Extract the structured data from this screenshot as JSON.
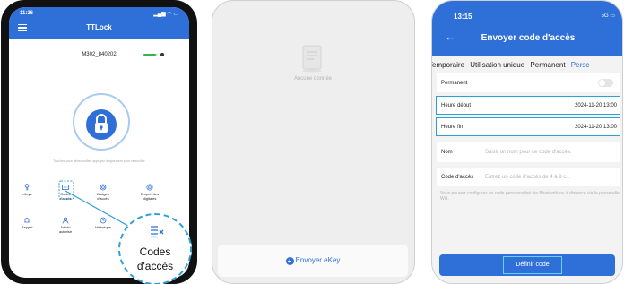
{
  "phone1": {
    "time": "11:36",
    "status_icons": "signal-wifi-battery",
    "title": "TTLock",
    "lock_name": "M302_840202",
    "battery_level": 0.85,
    "hint": "Touchez pour déverrouiller, appuyez longuement pour verrouiller",
    "menu": [
      {
        "label": "eKeys",
        "icon": "key-icon"
      },
      {
        "label": "Codes d'accès",
        "icon": "passcode-icon"
      },
      {
        "label": "Badges d'accès",
        "icon": "card-icon"
      },
      {
        "label": "Empreintes digitales",
        "icon": "fingerprint-icon"
      },
      {
        "label": "Rappel",
        "icon": "bell-icon"
      },
      {
        "label": "Admin autorisé",
        "icon": "admin-icon"
      },
      {
        "label": "Historique",
        "icon": "history-icon"
      },
      {
        "label": "Paramètres",
        "icon": "gear-icon"
      }
    ],
    "zoom_label": "Codes d'accès"
  },
  "phone2": {
    "empty_text": "Aucune donnée",
    "send_button": "Envoyer eKey"
  },
  "phone3": {
    "time": "13:15",
    "status_text": "5G",
    "title": "Envoyer code d'accès",
    "tabs": [
      "Temporaire",
      "Utilisation unique",
      "Permanent",
      "Persc"
    ],
    "selected_tab": "Persc",
    "permanent_label": "Permanent",
    "permanent_on": false,
    "start_label": "Heure début",
    "start_value": "2024-11-20 13:00",
    "end_label": "Heure fin",
    "end_value": "2024-11-20 13:00",
    "name_label": "Nom",
    "name_placeholder": "Saisir un nom pour ce code d'accès.",
    "code_label": "Code d'accès",
    "code_placeholder": "Entrez un code d'accès de 4 à 9 c...",
    "note": "Vous pouvez configurer un code personnalisé via Bluetooth ou à distance via la passerelle Wifi.",
    "define_button": "Définir code"
  },
  "colors": {
    "brand_blue": "#2f6fd8",
    "highlight": "#2fa0d6"
  }
}
